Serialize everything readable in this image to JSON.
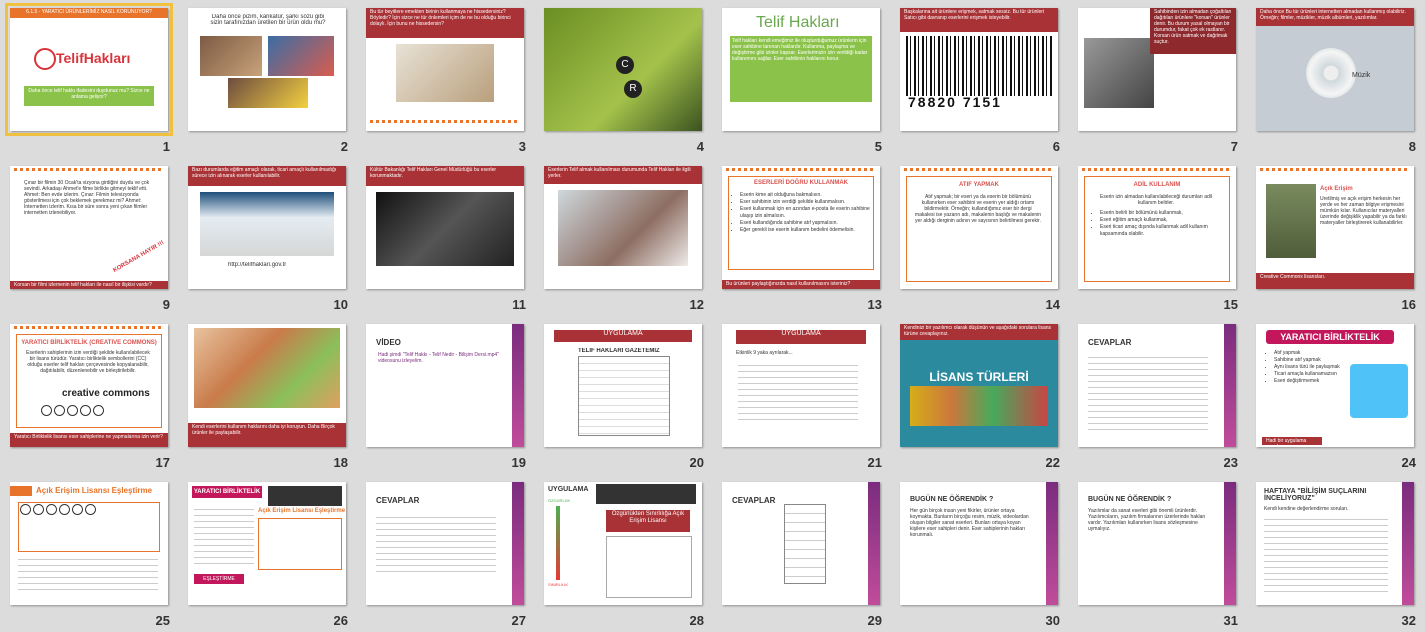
{
  "window": {
    "background": "#dcdcdc",
    "selected_slide": 1
  },
  "slides": [
    {
      "number": "1",
      "title": "6.1.5 - YARATICI ÜRÜNLERİMİZ NASIL KORUNUYOR?",
      "logo": "TelifHakları",
      "body": "Daha önce telif hakkı ifadesini duydunuz mu? Sizce ne anlama geliyor?"
    },
    {
      "number": "2",
      "body": "Daha önce pizim, karikatür, şarkı sözü gibi sizin tarafınızdan üretilen bir ürün oldu mu?"
    },
    {
      "number": "3",
      "body": "Bu tür beyitlere emekten birinin kullanmaya ne hissedersiniz? Böyledir? İçin sizce ne tür önlemleri içim de ne bu olduğu birinci dolaylı. İçin bunu ne hissedersin?"
    },
    {
      "number": "4",
      "body": ""
    },
    {
      "number": "5",
      "title": "Telif Hakları",
      "body": "Telif hakları kendi emeğimiz ile oluşturduğumuz ürünlerin için eser sahibine tanınan haklardır. Kullanma, paylaşma ve değiştirme gibi izinler kapsar. Eserlerimizin izin verildiği kadar kullanımını sağlar. Eser sahibinin haklarını korur."
    },
    {
      "number": "6",
      "body": "Başkalarına ait ürünlere erişmek, satmak sessiz. Bu tür ürünleri Satıcı gibi davranıp eserlerini erişmek isteyebilir.",
      "barcode": "78820 7151"
    },
    {
      "number": "7",
      "body": "Sahibinden izin almadan çoğaltılan dağıtılan ürünlere \"korsan\" ürünler denir. Bu durum yasal olmayan bir durumdur, fakat çok ek rastlanır. Korsan ürün satmak ve dağıtmak suçtur."
    },
    {
      "number": "8",
      "body": "Daha önce Bu tür ürünleri internetten almadan kullanmış olabiliriz. Örneğin; filmler, müzikler, müzik albümleri, yazılımlar.",
      "disc_label": "Müzik"
    },
    {
      "number": "9",
      "body": "Çınar bir filmin 30 Ocak'ta vizyona girdiğini duydu ve çok sevindi. Arkadaşı Ahmet'e filme birlikte gitmeyi teklif etti. Ahmet: Ben evde izlerim. Çınar: Filmin televizyonda gösterilmesi için çok beklemek gerekmez mi? Ahmet: İnternetten izlerim. Kısa bir süre sonra yeni çıkan filmler internetten izlenebiliyor.",
      "stamp": "KORSANA HAYIR !!!",
      "footer": "Korsan bir filmi izlemenin telif hakları ile nasıl bir ilişkisi vardır?"
    },
    {
      "number": "10",
      "body": "Bazı durumlarda eğitim amaçlı olarak, ticari amaçlı kullanılmadığı sürece izin alınarak eserler kullanılabilir.",
      "url": "http://telifhaklari.gov.tr"
    },
    {
      "number": "11",
      "body": "Kültür Bakanlığı Telif Hakları Genel Müdürlüğü bu eserler korunmaktadır."
    },
    {
      "number": "12",
      "body": "Eserlerin Telif almak kullanılması durumunda Telif Hakları ile ilgili yerler."
    },
    {
      "number": "13",
      "heading": "ESERLERİ DOĞRU KULLANMAK",
      "items": [
        "Eserin kime ait olduğuna bakmalısın.",
        "Eser sahibinin izin verdiği şekilde kullanmalısın.",
        "Eseri kullanmak için en azından e-posta ile eserin sahibine ulaşıp izin almalısın.",
        "Eseri kullandığında sahibine atıf yapmalısın.",
        "Eğer gerekli ise eserin kullanım bedelini ödemelisin."
      ],
      "footer": "Bu ürünleri paylaştığınızda nasıl kullanılmasını isteriniz?"
    },
    {
      "number": "14",
      "heading": "ATIF YAPMAK",
      "body": "Atıf yapmak; bir eseri ya da eserin bir bölümünü kullanırken eser sahibini ve eserin yer aldığı ortamı bildirmektir. Örneğin; kullandığımız eser bir dergi makalesi ise yazarın adı, makalenin başlığı ve makalenin yer aldığı derginin adının ve sayısının belirtilmesi gerekir."
    },
    {
      "number": "15",
      "heading": "ADİL KULLANIM",
      "body": "Eserin izin almadan kullanılabileceği durumları adil kullanım belirler.",
      "items": [
        "Eserin belirli bir bölümünü kullanmak,",
        "Eseri eğitim amaçlı kullanmak,",
        "Eseri ticari amaç dışında kullanmak adil kullanım kapsamında olabilir."
      ]
    },
    {
      "number": "16",
      "heading": "Açık Erişim",
      "body": "Üretilmiş ve açık erişim herkesin her yerde ve her zaman bilgiye erişmesini mümkün kılar. Kullanıcılar materyalleri üzerinde değişiklik yapabilir ya da farklı materyaller birleştirerek kullanabilirler.",
      "footer": "Creative Commons lisansları."
    },
    {
      "number": "17",
      "heading": "YARATICI BİRLİKTELİK (CREATIVE COMMONS)",
      "body": "Eserlerin sahiplerinin izin verdiği şekilde kullanılabilecek bir lisans türüdür. Yaratıcı birliktelik sembollerini (CC) olduğu eserler telif hakları çerçevesinde kopyalanabilir, dağıtılabilir, düzenlenebilir ve birleştirilebilir.",
      "logo": "creative commons",
      "footer": "Yaratıcı Birliktelik lisansı eser sahiplerine ne yapmalarına izin verir?"
    },
    {
      "number": "18",
      "body": "Kendi eserlerini kullanım haklarını daha iyi koruyun. Daha Birçok ürünler ile paylaşabilir."
    },
    {
      "number": "19",
      "heading": "VİDEO",
      "body": "Hadi şimdi \"Telif Hakkı - Telif Nedir - Bilişim Dersi.mp4\" videosunu izleyelim."
    },
    {
      "number": "20",
      "heading": "UYGULAMA",
      "sub": "TELİF HAKLARI GAZETEMİZ"
    },
    {
      "number": "21",
      "heading": "UYGULAMA",
      "body": "Etkinlik 9 yaka ayrılarak..."
    },
    {
      "number": "22",
      "heading": "LİSANS TÜRLERİ",
      "body": "Kendinizi bir yazılımcı olarak düşünün ve aşağıdaki sorulara lisans türüne cevaplayınız."
    },
    {
      "number": "23",
      "heading": "CEVAPLAR"
    },
    {
      "number": "24",
      "heading": "YARATICI BİRLİKTELİK",
      "items": [
        "Atıf yapmak",
        "Sahibine atıf yapmak",
        "Aynı lisans türü ile paylaşmak",
        "Ticari amaçla kullanamazsın",
        "Eseri değiştirmemek"
      ],
      "footer": "Hadi bir uygulama yapalım."
    },
    {
      "number": "25",
      "heading": "Açık Erişim Lisansı Eşleştirme"
    },
    {
      "number": "26",
      "heading": "YARATICI BİRLİKTELİK",
      "sub": "Açık Erişim Lisansı Eşleştirme",
      "footer": "EŞLEŞTİRME"
    },
    {
      "number": "27",
      "heading": "CEVAPLAR"
    },
    {
      "number": "28",
      "heading": "UYGULAMA",
      "sub": "Özgürlükten Sınırlılığa Açık Erişim Lisansı",
      "labels": [
        "ÖZGÜRLÜK",
        "SINIRLILIK"
      ]
    },
    {
      "number": "29",
      "heading": "CEVAPLAR"
    },
    {
      "number": "30",
      "heading": "BUGÜN NE ÖĞRENDİK ?",
      "body": "Her gün birçok insan yeni fikirler, ürünler ortaya koymakta. Bunların birçoğu resim, müzik, videolardan oluşan bilgiler sanat eserleri. Bunları ortaya koyan kişilere eser sahipleri denir. Eser sahiplerinin hakları korunmalı."
    },
    {
      "number": "31",
      "heading": "BUGÜN NE ÖĞRENDİK ?",
      "body": "Yazılımlar da sanat eserleri gibi önemli ürünlerdir. Yazılımcıların, yazılım firmalarının üzerlerinde hakları vardır. Yazılımları kullanırken lisans sözleşmesine uymalıyız."
    },
    {
      "number": "32",
      "heading": "HAFTAYA \"BİLİŞİM SUÇLARINI İNCELİYORUZ\"",
      "body": "Kendi kendine değerlendirme soruları."
    }
  ]
}
